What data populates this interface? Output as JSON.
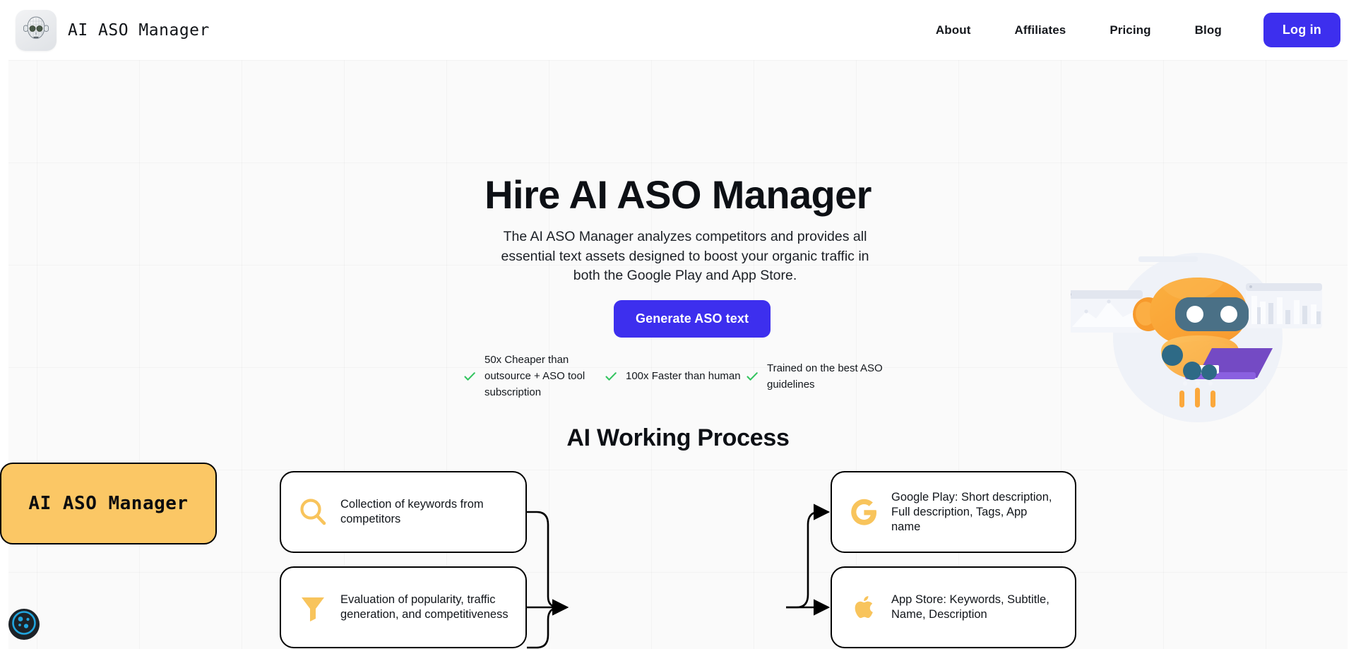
{
  "header": {
    "brand_name": "AI ASO Manager",
    "logo_icon": "robot-head-icon",
    "nav": [
      {
        "label": "About"
      },
      {
        "label": "Affiliates"
      },
      {
        "label": "Pricing"
      },
      {
        "label": "Blog"
      }
    ],
    "login_label": "Log in"
  },
  "hero": {
    "title": "Hire AI ASO Manager",
    "subtitle": "The AI ASO Manager analyzes competitors and provides all essential text assets designed to boost your organic traffic in both the Google Play and App Store.",
    "cta_label": "Generate ASO text",
    "features": [
      {
        "icon": "check-icon",
        "text": "50x Cheaper than outsource + ASO tool subscription"
      },
      {
        "icon": "check-icon",
        "text": "100x Faster than human"
      },
      {
        "icon": "check-icon",
        "text": "Trained on the best ASO guidelines"
      }
    ],
    "illustration": "robot-with-laptop-illustration"
  },
  "process": {
    "title": "AI Working Process",
    "inputs": [
      {
        "icon": "magnifier-icon",
        "text": "Collection of keywords from competitors"
      },
      {
        "icon": "funnel-icon",
        "text": "Evaluation of popularity, traffic generation, and competitiveness"
      }
    ],
    "center": {
      "label": "AI ASO Manager"
    },
    "outputs": [
      {
        "icon": "google-play-g-icon",
        "text": "Google Play: Short description, Full description, Tags, App name"
      },
      {
        "icon": "apple-icon",
        "text": "App Store: Keywords, Subtitle, Name, Description"
      }
    ]
  },
  "cookie": {
    "icon": "cookie-icon"
  },
  "colors": {
    "accent_blue": "#3D2FEE",
    "node_yellow": "#FBC765",
    "icon_yellow": "#F8C45C",
    "check_green": "#33C45F",
    "canvas_bg": "#FAFAFA",
    "text_dark": "#0d1015"
  }
}
